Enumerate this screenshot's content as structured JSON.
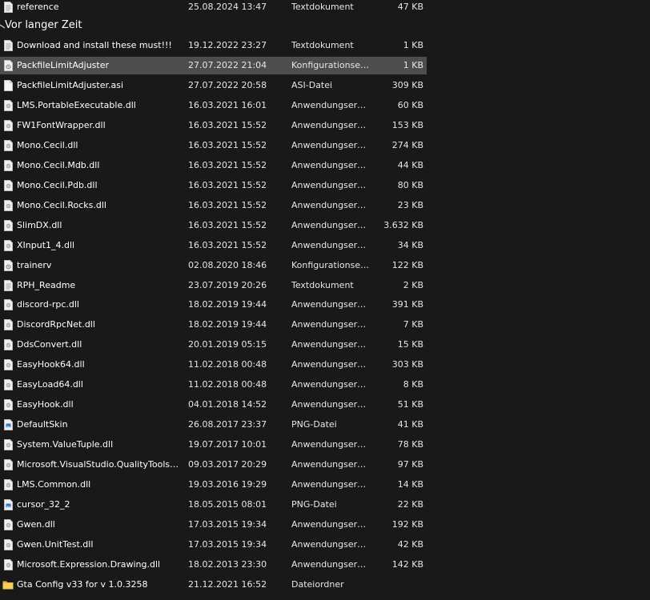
{
  "group_header": "Vor langer Zeit",
  "top_row": {
    "name": "reference",
    "date": "25.08.2024 13:47",
    "type": "Textdokument",
    "size": "47 KB",
    "icon": "text-file-icon"
  },
  "files": [
    {
      "name": "Download and install these must!!!",
      "date": "19.12.2022 23:27",
      "type": "Textdokument",
      "size": "1 KB",
      "icon": "text-file-icon"
    },
    {
      "name": "PackfileLimitAdjuster",
      "date": "27.07.2022 21:04",
      "type": "Konfigurationseinstellungen",
      "size": "1 KB",
      "icon": "config-file-icon",
      "selected": true
    },
    {
      "name": "PackfileLimitAdjuster.asi",
      "date": "27.07.2022 20:58",
      "type": "ASI-Datei",
      "size": "309 KB",
      "icon": "blank-file-icon"
    },
    {
      "name": "LMS.PortableExecutable.dll",
      "date": "16.03.2021 16:01",
      "type": "Anwendungserweiterung",
      "size": "60 KB",
      "icon": "dll-file-icon"
    },
    {
      "name": "FW1FontWrapper.dll",
      "date": "16.03.2021 15:52",
      "type": "Anwendungserweiterung",
      "size": "153 KB",
      "icon": "dll-file-icon"
    },
    {
      "name": "Mono.Cecil.dll",
      "date": "16.03.2021 15:52",
      "type": "Anwendungserweiterung",
      "size": "274 KB",
      "icon": "dll-file-icon"
    },
    {
      "name": "Mono.Cecil.Mdb.dll",
      "date": "16.03.2021 15:52",
      "type": "Anwendungserweiterung",
      "size": "44 KB",
      "icon": "dll-file-icon"
    },
    {
      "name": "Mono.Cecil.Pdb.dll",
      "date": "16.03.2021 15:52",
      "type": "Anwendungserweiterung",
      "size": "80 KB",
      "icon": "dll-file-icon"
    },
    {
      "name": "Mono.Cecil.Rocks.dll",
      "date": "16.03.2021 15:52",
      "type": "Anwendungserweiterung",
      "size": "23 KB",
      "icon": "dll-file-icon"
    },
    {
      "name": "SlimDX.dll",
      "date": "16.03.2021 15:52",
      "type": "Anwendungserweiterung",
      "size": "3.632 KB",
      "icon": "dll-file-icon"
    },
    {
      "name": "XInput1_4.dll",
      "date": "16.03.2021 15:52",
      "type": "Anwendungserweiterung",
      "size": "34 KB",
      "icon": "dll-file-icon"
    },
    {
      "name": "trainerv",
      "date": "02.08.2020 18:46",
      "type": "Konfigurationseinstellungen",
      "size": "122 KB",
      "icon": "config-file-icon"
    },
    {
      "name": "RPH_Readme",
      "date": "23.07.2019 20:26",
      "type": "Textdokument",
      "size": "2 KB",
      "icon": "text-file-icon"
    },
    {
      "name": "discord-rpc.dll",
      "date": "18.02.2019 19:44",
      "type": "Anwendungserweiterung",
      "size": "391 KB",
      "icon": "dll-file-icon"
    },
    {
      "name": "DiscordRpcNet.dll",
      "date": "18.02.2019 19:44",
      "type": "Anwendungserweiterung",
      "size": "7 KB",
      "icon": "dll-file-icon"
    },
    {
      "name": "DdsConvert.dll",
      "date": "20.01.2019 05:15",
      "type": "Anwendungserweiterung",
      "size": "15 KB",
      "icon": "dll-file-icon"
    },
    {
      "name": "EasyHook64.dll",
      "date": "11.02.2018 00:48",
      "type": "Anwendungserweiterung",
      "size": "303 KB",
      "icon": "dll-file-icon"
    },
    {
      "name": "EasyLoad64.dll",
      "date": "11.02.2018 00:48",
      "type": "Anwendungserweiterung",
      "size": "8 KB",
      "icon": "dll-file-icon"
    },
    {
      "name": "EasyHook.dll",
      "date": "04.01.2018 14:52",
      "type": "Anwendungserweiterung",
      "size": "51 KB",
      "icon": "dll-file-icon"
    },
    {
      "name": "DefaultSkin",
      "date": "26.08.2017 23:37",
      "type": "PNG-Datei",
      "size": "41 KB",
      "icon": "png-file-icon"
    },
    {
      "name": "System.ValueTuple.dll",
      "date": "19.07.2017 10:01",
      "type": "Anwendungserweiterung",
      "size": "78 KB",
      "icon": "dll-file-icon"
    },
    {
      "name": "Microsoft.VisualStudio.QualityTools.UnitTestFramework.dll",
      "date": "09.03.2017 20:29",
      "type": "Anwendungserweiterung",
      "size": "97 KB",
      "icon": "dll-file-icon"
    },
    {
      "name": "LMS.Common.dll",
      "date": "19.03.2016 19:29",
      "type": "Anwendungserweiterung",
      "size": "14 KB",
      "icon": "dll-file-icon"
    },
    {
      "name": "cursor_32_2",
      "date": "18.05.2015 08:01",
      "type": "PNG-Datei",
      "size": "22 KB",
      "icon": "png-file-icon"
    },
    {
      "name": "Gwen.dll",
      "date": "17.03.2015 19:34",
      "type": "Anwendungserweiterung",
      "size": "192 KB",
      "icon": "dll-file-icon"
    },
    {
      "name": "Gwen.UnitTest.dll",
      "date": "17.03.2015 19:34",
      "type": "Anwendungserweiterung",
      "size": "42 KB",
      "icon": "dll-file-icon"
    },
    {
      "name": "Microsoft.Expression.Drawing.dll",
      "date": "18.02.2013 23:30",
      "type": "Anwendungserweiterung",
      "size": "142 KB",
      "icon": "dll-file-icon"
    },
    {
      "name": "Gta Config v33 for v 1.0.3258",
      "date": "21.12.2021 16:52",
      "type": "Dateiordner",
      "size": "",
      "icon": "folder-icon"
    }
  ]
}
